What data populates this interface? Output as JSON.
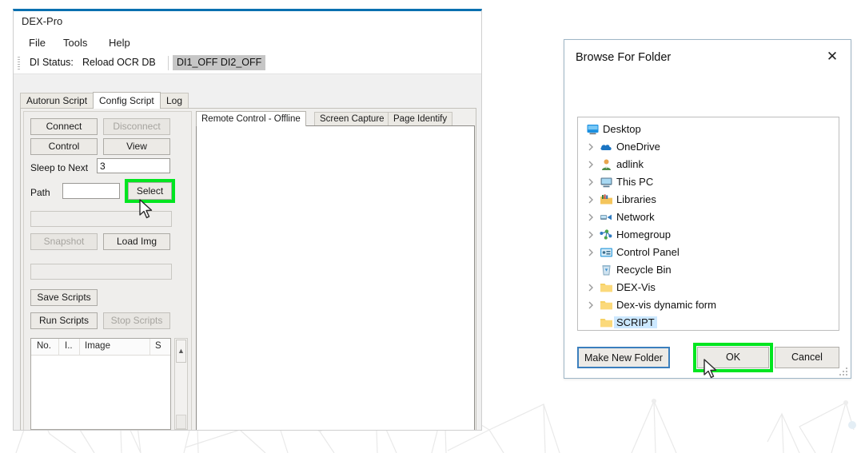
{
  "app": {
    "title": "DEX-Pro",
    "menu": [
      {
        "label": "File"
      },
      {
        "label": "Tools"
      },
      {
        "label": "Help"
      }
    ],
    "toolbar": {
      "di_status_label": "DI Status:",
      "reload_label": "Reload OCR DB",
      "di_state": "DI1_OFF  DI2_OFF"
    },
    "tabs": [
      {
        "label": "Autorun Script",
        "active": false
      },
      {
        "label": "Config Script",
        "active": true
      },
      {
        "label": "Log",
        "active": false
      }
    ],
    "left_panel": {
      "connect": "Connect",
      "disconnect": "Disconnect",
      "control": "Control",
      "view": "View",
      "sleep_label": "Sleep to Next",
      "sleep_value": "3",
      "path_label": "Path",
      "path_value": "",
      "select": "Select",
      "snapshot": "Snapshot",
      "load_img": "Load Img",
      "save_scripts": "Save Scripts",
      "run_scripts": "Run Scripts",
      "stop_scripts": "Stop Scripts",
      "list_columns": [
        "No.",
        "I..",
        "Image",
        "S"
      ],
      "list_rows": [],
      "scroll_up_icon": "arrow-up-icon"
    },
    "right_panel": {
      "tabs": [
        {
          "label": "Remote Control - Offline",
          "active": true
        },
        {
          "label": "Screen Capture",
          "active": false
        },
        {
          "label": "Page Identify",
          "active": false
        }
      ]
    }
  },
  "dialog": {
    "title": "Browse For Folder",
    "close_icon": "close-icon",
    "tree": [
      {
        "label": "Desktop",
        "icon": "desktop-icon",
        "expandable": false,
        "root": true,
        "selected": false
      },
      {
        "label": "OneDrive",
        "icon": "cloud-icon",
        "expandable": true,
        "root": false,
        "selected": false
      },
      {
        "label": "adlink",
        "icon": "user-icon",
        "expandable": true,
        "root": false,
        "selected": false
      },
      {
        "label": "This PC",
        "icon": "computer-icon",
        "expandable": true,
        "root": false,
        "selected": false
      },
      {
        "label": "Libraries",
        "icon": "libraries-icon",
        "expandable": true,
        "root": false,
        "selected": false
      },
      {
        "label": "Network",
        "icon": "network-icon",
        "expandable": true,
        "root": false,
        "selected": false
      },
      {
        "label": "Homegroup",
        "icon": "homegroup-icon",
        "expandable": true,
        "root": false,
        "selected": false
      },
      {
        "label": "Control Panel",
        "icon": "controlpanel-icon",
        "expandable": true,
        "root": false,
        "selected": false
      },
      {
        "label": "Recycle Bin",
        "icon": "recyclebin-icon",
        "expandable": false,
        "root": false,
        "selected": false
      },
      {
        "label": "DEX-Vis",
        "icon": "folder-icon",
        "expandable": true,
        "root": false,
        "selected": false
      },
      {
        "label": "Dex-vis dynamic form",
        "icon": "folder-icon",
        "expandable": true,
        "root": false,
        "selected": false
      },
      {
        "label": "SCRIPT",
        "icon": "folder-icon",
        "expandable": false,
        "root": false,
        "selected": true
      }
    ],
    "buttons": {
      "make_new_folder": "Make New Folder",
      "ok": "OK",
      "cancel": "Cancel"
    }
  },
  "highlights": {
    "accent_green": "#00e520",
    "focus_blue": "#3b7fbd",
    "selection_blue": "#cce8ff",
    "window_border_blue": "#0a70b0"
  }
}
